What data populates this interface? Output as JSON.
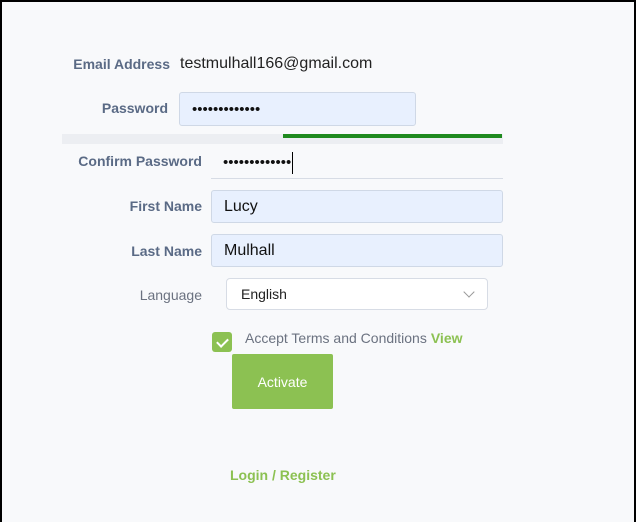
{
  "form": {
    "email_label": "Email Address",
    "email_value": "testmulhall166@gmail.com",
    "password_label": "Password",
    "password_value": "•••••••••••••",
    "confirm_label": "Confirm Password",
    "confirm_value": "•••••••••••••",
    "first_name_label": "First Name",
    "first_name_value": "Lucy",
    "last_name_label": "Last Name",
    "last_name_value": "Mulhall",
    "language_label": "Language",
    "language_value": "English",
    "terms_text": "Accept Terms and Conditions",
    "terms_link": "View",
    "terms_checked": true,
    "activate_label": "Activate",
    "password_strength": 0.5
  },
  "footer": {
    "login_register": "Login / Register"
  },
  "colors": {
    "accent": "#8cc152",
    "strength_good": "#1f8a1f",
    "autofill_bg": "#e8f0fe"
  },
  "icons": {
    "language_dropdown": "chevron-down-icon",
    "terms_checkbox": "checkmark-icon"
  }
}
